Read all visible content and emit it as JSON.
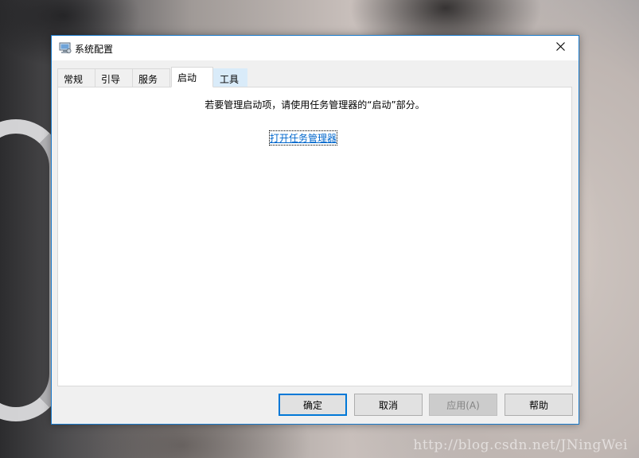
{
  "window": {
    "title": "系统配置",
    "accent_color": "#1979ca"
  },
  "tabs": [
    {
      "label": "常规",
      "state": "normal"
    },
    {
      "label": "引导",
      "state": "normal"
    },
    {
      "label": "服务",
      "state": "normal"
    },
    {
      "label": "启动",
      "state": "selected"
    },
    {
      "label": "工具",
      "state": "hover"
    }
  ],
  "startup": {
    "message": "若要管理启动项，请使用任务管理器的“启动”部分。",
    "link_text": "打开任务管理器",
    "link_color": "#0066cc"
  },
  "buttons": {
    "ok": "确定",
    "cancel": "取消",
    "apply": "应用(A)",
    "help": "帮助"
  },
  "watermark": "http://blog.csdn.net/JNingWei",
  "icons": {
    "app": "system-config-icon",
    "close": "close-icon"
  }
}
